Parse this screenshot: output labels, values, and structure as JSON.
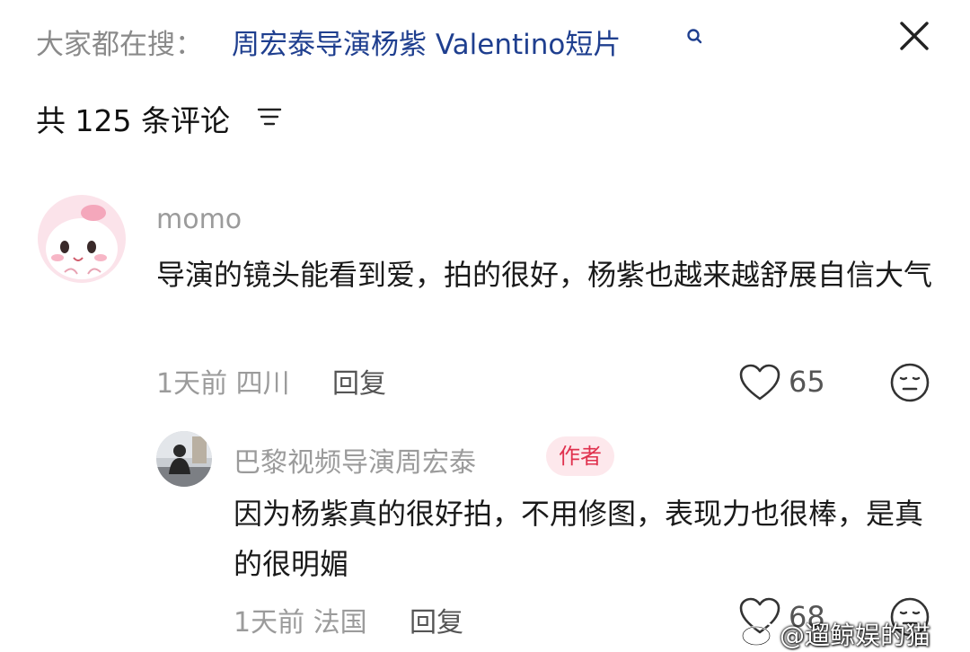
{
  "header": {
    "search_prefix": "大家都在搜：",
    "search_query": "周宏泰导演杨紫 Valentino短片",
    "comment_count_label": "共 125 条评论"
  },
  "comments": [
    {
      "username": "momo",
      "text": "导演的镜头能看到爱，拍的很好，杨紫也越来越舒展自信大气",
      "meta": "1天前 四川",
      "reply_label": "回复",
      "likes": "65"
    },
    {
      "username": "巴黎视频导演周宏泰",
      "badge": "作者",
      "text": "因为杨紫真的很好拍，不用修图，表现力也很棒，是真的很明媚",
      "meta": "1天前 法国",
      "reply_label": "回复",
      "likes": "68"
    }
  ],
  "watermark": "@遛鲸娱的猫",
  "colors": {
    "link": "#1f3f8f",
    "badge_text": "#e0314e",
    "badge_bg": "#fde8ec",
    "muted": "#9b9b9b"
  }
}
